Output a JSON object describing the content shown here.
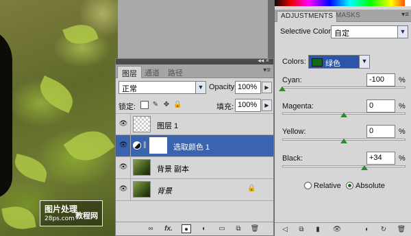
{
  "watermark": {
    "line1": "图片处理",
    "line2": "28ps.com",
    "line3": "教程网"
  },
  "layers_panel": {
    "tabs": [
      "图层",
      "通道",
      "路径"
    ],
    "menu_icon": "panel-menu-icon",
    "collapse_icon": "double-arrow-icon",
    "blend_mode": "正常",
    "opacity_label": "Opacity:",
    "opacity_value": "100%",
    "lock_label": "锁定:",
    "fill_label": "填充:",
    "fill_value": "100%",
    "layers": [
      {
        "name": "图层 1",
        "thumb": "transparent",
        "visible": true,
        "selected": false
      },
      {
        "name": "选取颜色 1",
        "thumb": "adjustment-mask",
        "visible": true,
        "selected": true
      },
      {
        "name": "背景 副本",
        "thumb": "photo",
        "visible": true,
        "selected": false
      },
      {
        "name": "背景",
        "thumb": "photo",
        "visible": true,
        "selected": false,
        "locked": true,
        "italic": true
      }
    ],
    "bottom_icons": [
      "link-icon",
      "fx-icon",
      "mask-icon",
      "adjustment-icon",
      "folder-icon",
      "new-layer-icon",
      "trash-icon"
    ],
    "fx_label": "fx."
  },
  "adjustments_panel": {
    "tabs": [
      "ADJUSTMENTS",
      "MASKS"
    ],
    "type_label": "Selective Color",
    "preset_value": "自定",
    "colors_label": "Colors:",
    "colors_value": "绿色",
    "colors_swatch": "#0f6a10",
    "sliders": [
      {
        "label": "Cyan:",
        "value": "-100",
        "unit": "%",
        "pct": 0
      },
      {
        "label": "Magenta:",
        "value": "0",
        "unit": "%",
        "pct": 50
      },
      {
        "label": "Yellow:",
        "value": "0",
        "unit": "%",
        "pct": 50
      },
      {
        "label": "Black:",
        "value": "+34",
        "unit": "%",
        "pct": 67
      }
    ],
    "method_relative": "Relative",
    "method_absolute": "Absolute",
    "method_selected": "Absolute"
  }
}
